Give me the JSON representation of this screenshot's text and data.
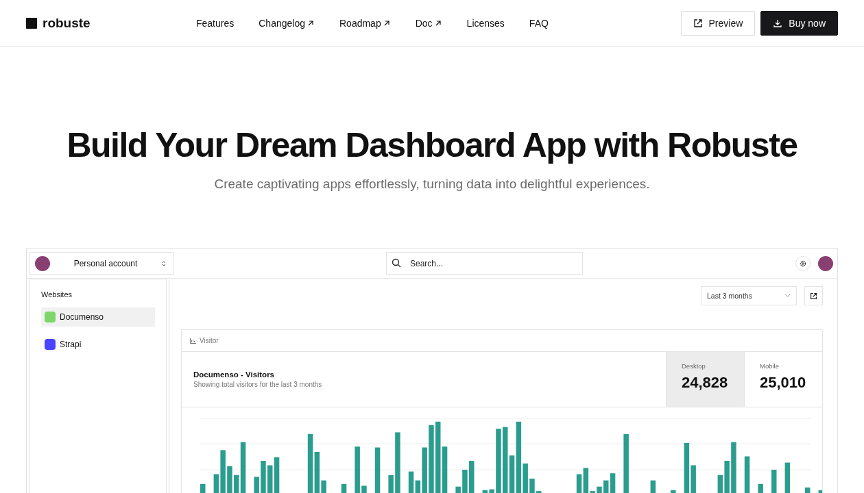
{
  "brand": {
    "name": "robuste"
  },
  "nav": [
    {
      "label": "Features",
      "external": false
    },
    {
      "label": "Changelog",
      "external": true
    },
    {
      "label": "Roadmap",
      "external": true
    },
    {
      "label": "Doc",
      "external": true
    },
    {
      "label": "Licenses",
      "external": false
    },
    {
      "label": "FAQ",
      "external": false
    }
  ],
  "actions": [
    {
      "kind": "outline",
      "label": "Preview"
    },
    {
      "kind": "solid",
      "label": "Buy now"
    }
  ],
  "hero": {
    "title": "Build Your Dream Dashboard App with Robuste",
    "subtitle": "Create captivating apps effortlessly, turning data into delightful experiences."
  },
  "app": {
    "account": "Personal account",
    "search": {
      "placeholder": "Search..."
    },
    "sidebar": {
      "heading": "Websites",
      "items": [
        {
          "label": "Documenso",
          "selected": true,
          "color": "#7ed66b"
        },
        {
          "label": "Strapi",
          "selected": false,
          "color": "#4945ff"
        }
      ]
    },
    "range": {
      "value": "Last 3 months"
    },
    "card": {
      "tab": "Visitor",
      "title": "Documenso - Visitors",
      "description": "Showing total visitors for the last 3 months",
      "stats": [
        {
          "label": "Desktop",
          "value": "24,828",
          "selected": true
        },
        {
          "label": "Mobile",
          "value": "25,010",
          "selected": false
        }
      ]
    }
  }
}
